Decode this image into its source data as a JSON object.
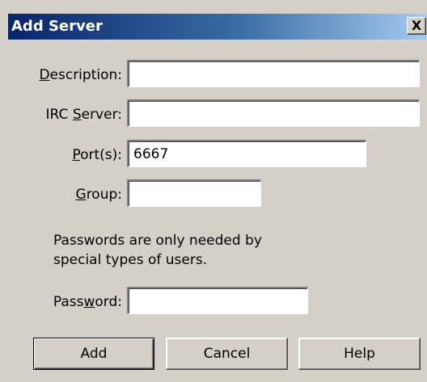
{
  "window": {
    "title": "Add Server",
    "close_glyph": "X",
    "close_icon": "close-icon"
  },
  "form": {
    "description": {
      "label_pre": "",
      "label_key": "D",
      "label_post": "escription:",
      "value": ""
    },
    "irc_server": {
      "label_pre": "IRC ",
      "label_key": "S",
      "label_post": "erver:",
      "value": ""
    },
    "ports": {
      "label_pre": "",
      "label_key": "P",
      "label_post": "ort(s):",
      "value": "6667"
    },
    "group": {
      "label_pre": "",
      "label_key": "G",
      "label_post": "roup:",
      "value": ""
    },
    "note_line1": "Passwords are only needed by",
    "note_line2": "special types of users.",
    "password": {
      "label_pre": "Pass",
      "label_key": "w",
      "label_post": "ord:",
      "value": ""
    }
  },
  "buttons": {
    "add": "Add",
    "cancel": "Cancel",
    "help": "Help"
  }
}
